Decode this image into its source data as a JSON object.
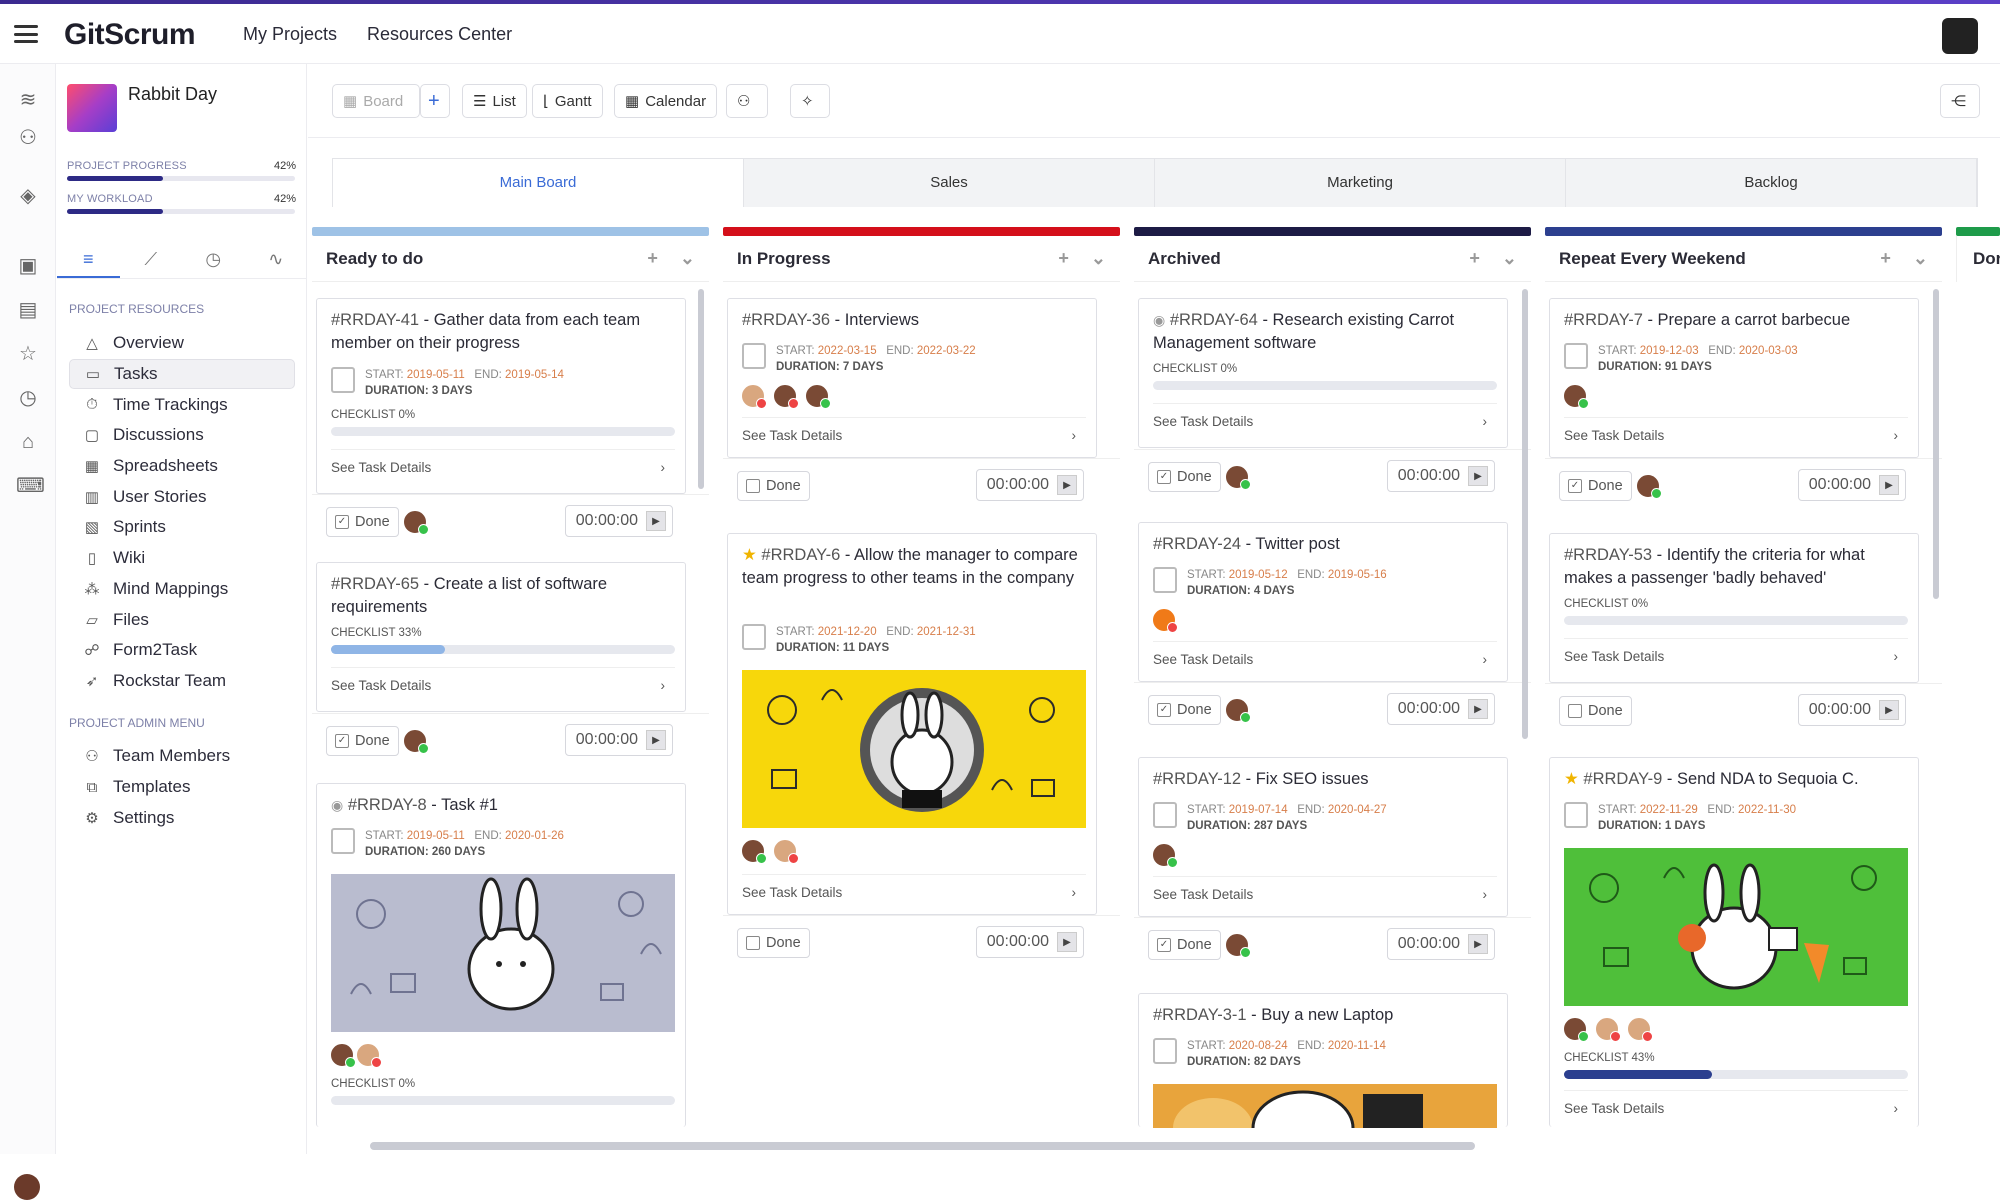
{
  "app": {
    "brand": "GitScrum",
    "nav": [
      "My Projects",
      "Resources Center"
    ]
  },
  "project": {
    "name": "Rabbit Day",
    "progress_label": "PROJECT PROGRESS",
    "progress_value": "42%",
    "progress": 0.42,
    "workload_label": "MY WORKLOAD",
    "workload_value": "42%",
    "workload": 0.42
  },
  "sidebar": {
    "resources_title": "PROJECT RESOURCES",
    "items": [
      {
        "label": "Overview",
        "icon": "triangle-icon"
      },
      {
        "label": "Tasks",
        "icon": "square-icon"
      },
      {
        "label": "Time Trackings",
        "icon": "stopwatch-icon"
      },
      {
        "label": "Discussions",
        "icon": "chat-icon"
      },
      {
        "label": "Spreadsheets",
        "icon": "spreadsheet-icon"
      },
      {
        "label": "User Stories",
        "icon": "stories-icon"
      },
      {
        "label": "Sprints",
        "icon": "sprints-icon"
      },
      {
        "label": "Wiki",
        "icon": "book-icon"
      },
      {
        "label": "Mind Mappings",
        "icon": "mindmap-icon"
      },
      {
        "label": "Files",
        "icon": "folder-icon"
      },
      {
        "label": "Form2Task",
        "icon": "form-icon"
      },
      {
        "label": "Rockstar Team",
        "icon": "rocket-icon"
      }
    ],
    "admin_title": "PROJECT ADMIN MENU",
    "admin_items": [
      {
        "label": "Team Members",
        "icon": "team-icon"
      },
      {
        "label": "Templates",
        "icon": "templates-icon"
      },
      {
        "label": "Settings",
        "icon": "gear-icon"
      }
    ]
  },
  "toolbar": {
    "board": "Board",
    "plus": "+",
    "list": "List",
    "gantt": "Gantt",
    "calendar": "Calendar"
  },
  "board_tabs": [
    "Main Board",
    "Sales",
    "Marketing",
    "Backlog"
  ],
  "columns": [
    {
      "title": "Ready to do",
      "color": "#9ec2e6"
    },
    {
      "title": "In Progress",
      "color": "#d40f1a"
    },
    {
      "title": "Archived",
      "color": "#1d1b45"
    },
    {
      "title": "Repeat Every Weekend",
      "color": "#2c3f8f"
    },
    {
      "title": "Dor",
      "color": "#1e9b4a"
    }
  ],
  "common": {
    "start": "START:",
    "end": "END:",
    "duration": "DURATION:",
    "see": "See Task Details",
    "done": "Done",
    "timer": "00:00:00"
  },
  "cards": {
    "c41": {
      "id": "#RRDAY-41",
      "sep": " - ",
      "title": "Gather data from each team member on their progress",
      "start": "2019-05-11",
      "end": "2019-05-14",
      "duration": "3 DAYS",
      "checklist": "CHECKLIST 0%"
    },
    "c65": {
      "id": "#RRDAY-65",
      "sep": " - ",
      "title": "Create a list of software requirements",
      "checklist": "CHECKLIST 33%",
      "progress": 0.33
    },
    "c8": {
      "id": "#RRDAY-8",
      "sep": " - ",
      "title": "Task #1",
      "start": "2019-05-11",
      "end": "2020-01-26",
      "duration": "260 DAYS",
      "checklist": "CHECKLIST 0%"
    },
    "c36": {
      "id": "#RRDAY-36",
      "sep": " - ",
      "title": "Interviews",
      "start": "2022-03-15",
      "end": "2022-03-22",
      "duration": "7 DAYS"
    },
    "c6": {
      "id": "#RRDAY-6",
      "sep": " - ",
      "title": "Allow the manager to compare team progress to other teams in the company",
      "start": "2021-12-20",
      "end": "2021-12-31",
      "duration": "11 DAYS"
    },
    "c64": {
      "id": "#RRDAY-64",
      "sep": " - ",
      "title": "Research existing Carrot Management software",
      "checklist": "CHECKLIST 0%"
    },
    "c24": {
      "id": "#RRDAY-24",
      "sep": " - ",
      "title": "Twitter post",
      "start": "2019-05-12",
      "end": "2019-05-16",
      "duration": "4 DAYS"
    },
    "c12": {
      "id": "#RRDAY-12",
      "sep": " - ",
      "title": "Fix SEO issues",
      "start": "2019-07-14",
      "end": "2020-04-27",
      "duration": "287 DAYS"
    },
    "c3": {
      "id": "#RRDAY-3-1",
      "sep": " - ",
      "title": "Buy a new Laptop",
      "start": "2020-08-24",
      "end": "2020-11-14",
      "duration": "82 DAYS"
    },
    "c7": {
      "id": "#RRDAY-7",
      "sep": " - ",
      "title": "Prepare a carrot barbecue",
      "start": "2019-12-03",
      "end": "2020-03-03",
      "duration": "91 DAYS"
    },
    "c53": {
      "id": "#RRDAY-53",
      "sep": " - ",
      "title": "Identify the criteria for what makes a passenger 'badly behaved'",
      "checklist": "CHECKLIST 0%"
    },
    "c9": {
      "id": "#RRDAY-9",
      "sep": " - ",
      "title": "Send NDA to Sequoia C.",
      "start": "2022-11-29",
      "end": "2022-11-30",
      "duration": "1 DAYS",
      "checklist": "CHECKLIST 43%",
      "progress": 0.43
    }
  }
}
